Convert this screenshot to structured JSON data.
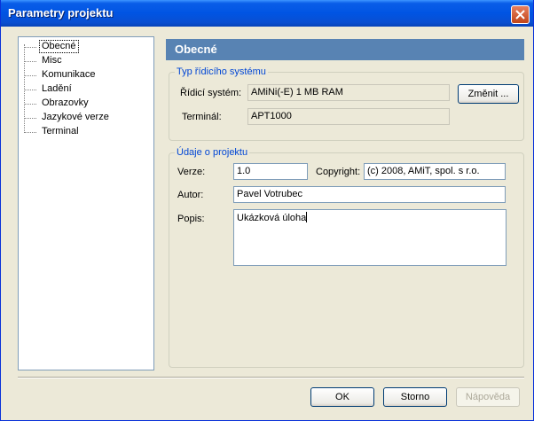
{
  "window": {
    "title": "Parametry projektu"
  },
  "tree": {
    "items": [
      {
        "label": "Obecné",
        "selected": true
      },
      {
        "label": "Misc"
      },
      {
        "label": "Komunikace"
      },
      {
        "label": "Ladění"
      },
      {
        "label": "Obrazovky"
      },
      {
        "label": "Jazykové verze"
      },
      {
        "label": "Terminal"
      }
    ]
  },
  "panel": {
    "title": "Obecné"
  },
  "system_group": {
    "legend": "Typ řídicího systému",
    "system_label": "Řídicí systém:",
    "system_value": "AMiNi(-E) 1 MB RAM",
    "change_button": "Změnit ...",
    "terminal_label": "Terminál:",
    "terminal_value": "APT1000"
  },
  "project_group": {
    "legend": "Údaje o projektu",
    "version_label": "Verze:",
    "version_value": "1.0",
    "copyright_label": "Copyright:",
    "copyright_value": "(c) 2008, AMiT, spol. s r.o.",
    "author_label": "Autor:",
    "author_value": "Pavel Votrubec",
    "description_label": "Popis:",
    "description_value": "Ukázková úloha"
  },
  "buttons": {
    "ok": "OK",
    "cancel": "Storno",
    "help": "Nápověda"
  },
  "colors": {
    "title_bar": "#0054e3",
    "panel_header": "#5883b3",
    "legend": "#0046d5",
    "dialog_bg": "#ece9d8"
  }
}
